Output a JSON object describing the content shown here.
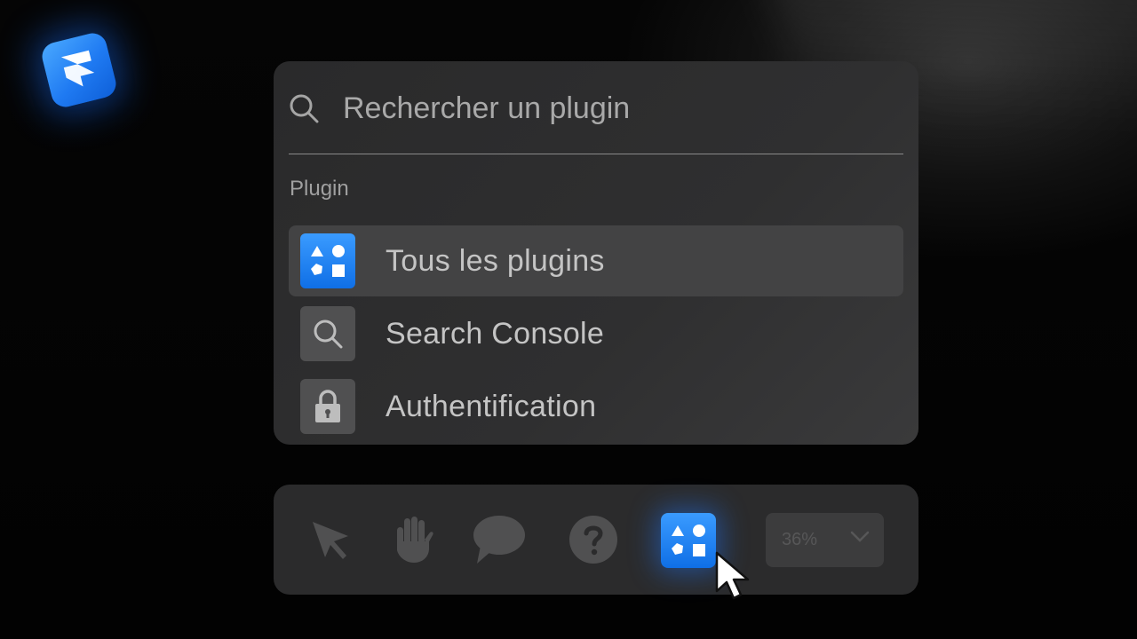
{
  "search": {
    "placeholder": "Rechercher un plugin"
  },
  "section": {
    "label": "Plugin"
  },
  "plugins": [
    {
      "label": "Tous les plugins",
      "icon": "shapes-icon",
      "selected": true
    },
    {
      "label": "Search Console",
      "icon": "search-icon",
      "selected": false
    },
    {
      "label": "Authentification",
      "icon": "lock-icon",
      "selected": false
    }
  ],
  "toolbar": {
    "tools": [
      {
        "name": "select-tool",
        "icon": "pointer-icon"
      },
      {
        "name": "hand-tool",
        "icon": "hand-icon"
      },
      {
        "name": "comment-tool",
        "icon": "speech-bubble-icon"
      },
      {
        "name": "help-tool",
        "icon": "question-icon"
      },
      {
        "name": "plugins-tool",
        "icon": "shapes-icon"
      }
    ],
    "zoom": "36%"
  },
  "colors": {
    "accent": "#1f7af2",
    "panel": "#2f2f30",
    "selected_row": "#434344",
    "text": "#c4c4c4"
  }
}
